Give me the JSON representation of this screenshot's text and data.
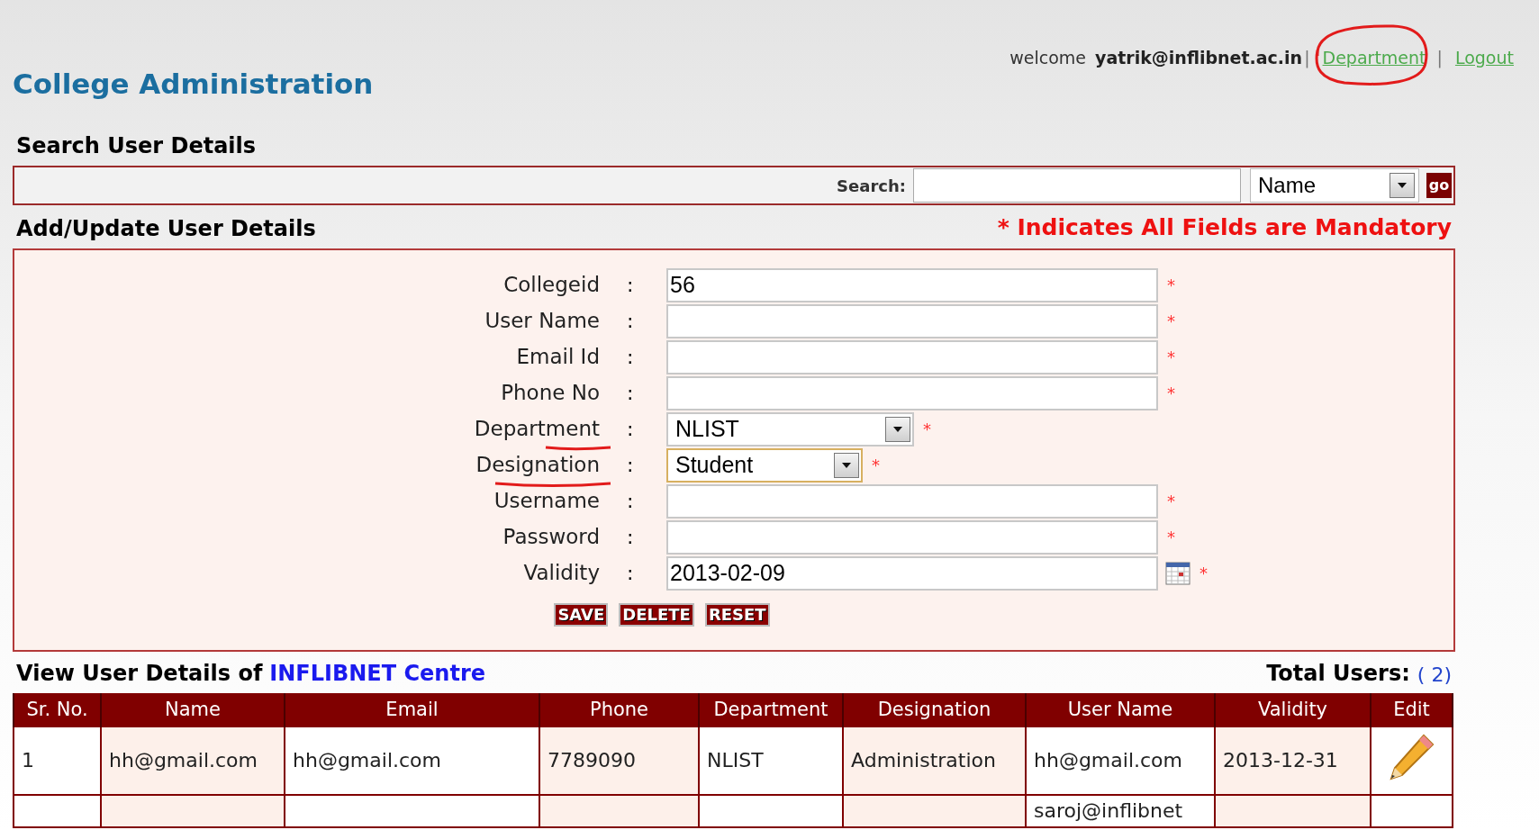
{
  "header": {
    "title": "College Administration",
    "welcome": [
      {
        "kind": "text",
        "text": "welcome"
      },
      {
        "kind": "user",
        "text": "yatrik@inflibnet.ac.in"
      },
      {
        "kind": "sep",
        "text": "|"
      },
      {
        "kind": "link",
        "text": "Department"
      },
      {
        "kind": "sep",
        "text": "|"
      },
      {
        "kind": "link",
        "text": "Logout"
      }
    ]
  },
  "search_section": {
    "heading": "Search User Details",
    "label": "Search:",
    "select": "Name",
    "go_button": "go"
  },
  "form_section": {
    "heading": "Add/Update User Details",
    "note": "* Indicates All Fields are Mandatory",
    "fields": [
      {
        "kind": "input",
        "label": "Collegeid",
        "separator": ":",
        "value": "56",
        "required_mark": "*",
        "focused": false
      },
      {
        "kind": "input",
        "label": "User Name",
        "separator": ":",
        "required_mark": "*",
        "focused": false
      },
      {
        "kind": "input",
        "label": "Email Id",
        "separator": ":",
        "required_mark": "*",
        "focused": false
      },
      {
        "kind": "input",
        "label": "Phone No",
        "separator": ":",
        "required_mark": "*",
        "focused": false
      },
      {
        "kind": "select",
        "label": "Department",
        "separator": ":",
        "value": "NLIST",
        "required_mark": "*",
        "focused": false
      },
      {
        "kind": "select_small",
        "label": "Designation",
        "separator": ":",
        "value": "Student",
        "required_mark": "*",
        "focused": true
      },
      {
        "kind": "input",
        "label": "Username",
        "separator": ":",
        "required_mark": "*",
        "focused": false
      },
      {
        "kind": "input",
        "label": "Password",
        "separator": ":",
        "required_mark": "*",
        "focused": false
      },
      {
        "kind": "date",
        "label": "Validity",
        "separator": ":",
        "value": "2013-02-09",
        "required_mark": "*",
        "focused": false
      }
    ],
    "buttons": [
      "SAVE",
      "DELETE",
      "RESET"
    ]
  },
  "table_section": {
    "heading": "View User Details of",
    "centre": "INFLIBNET Centre",
    "total_label": "Total Users:",
    "total_count": "( 2)",
    "columns": [
      "Sr. No.",
      "Name",
      "Email",
      "Phone",
      "Department",
      "Designation",
      "User Name",
      "Validity",
      "Edit"
    ],
    "rows": [
      {
        "cells": [
          {
            "text": "1"
          },
          {
            "text": "hh@gmail.com"
          },
          {
            "text": "hh@gmail.com"
          },
          {
            "text": "7789090"
          },
          {
            "text": "NLIST"
          },
          {
            "text": "Administration"
          },
          {
            "text": "hh@gmail.com"
          },
          {
            "text": "2013-12-31"
          }
        ]
      },
      {
        "cells": [
          {},
          {},
          {},
          {},
          {},
          {},
          {
            "text": "saroj@inflibnet"
          },
          {}
        ]
      }
    ]
  }
}
